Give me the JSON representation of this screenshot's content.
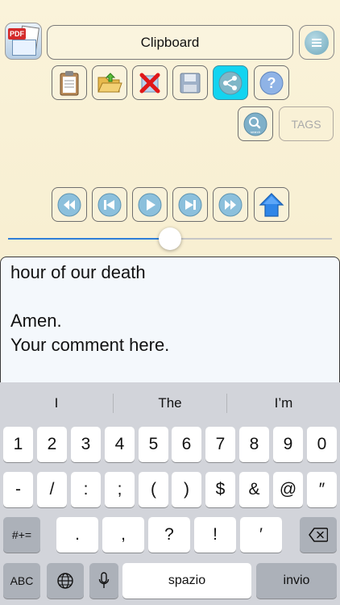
{
  "header": {
    "app_icon": "pdf-clipboard-app-icon",
    "app_icon_label": "PDF",
    "title": "Clipboard",
    "menu_icon": "hamburger-menu-icon"
  },
  "toolbar": {
    "items": [
      {
        "icon": "clipboard-icon"
      },
      {
        "icon": "folder-open-icon"
      },
      {
        "icon": "delete-x-icon"
      },
      {
        "icon": "save-floppy-icon"
      },
      {
        "icon": "share-icon",
        "active": true
      },
      {
        "icon": "help-icon"
      }
    ],
    "search_icon": "search-icon",
    "search_sub": "search",
    "tags_label": "TAGS"
  },
  "playback": {
    "items": [
      {
        "icon": "rewind-icon"
      },
      {
        "icon": "skip-back-icon"
      },
      {
        "icon": "play-icon"
      },
      {
        "icon": "skip-forward-icon"
      },
      {
        "icon": "fast-forward-icon"
      },
      {
        "icon": "home-icon"
      }
    ]
  },
  "slider": {
    "value_fraction": 0.5
  },
  "editor": {
    "text": "hour of our death\n\nAmen.\nYour comment here."
  },
  "keyboard": {
    "suggestions": [
      "I",
      "The",
      "I’m"
    ],
    "row1": [
      "1",
      "2",
      "3",
      "4",
      "5",
      "6",
      "7",
      "8",
      "9",
      "0"
    ],
    "row2": [
      "-",
      "/",
      ":",
      ";",
      "(",
      ")",
      "$",
      "&",
      "@",
      "″"
    ],
    "row3_left": "#+=",
    "row3": [
      ".",
      ",",
      "?",
      "!",
      "′"
    ],
    "row4_abc": "ABC",
    "row4_space": "spazio",
    "row4_return": "invio",
    "globe_icon": "globe-icon",
    "mic_icon": "microphone-icon",
    "backspace_icon": "backspace-icon"
  },
  "colors": {
    "active_tool": "#13d4f0",
    "slider_fill": "#2f7ed8",
    "background": "#faf3da"
  }
}
